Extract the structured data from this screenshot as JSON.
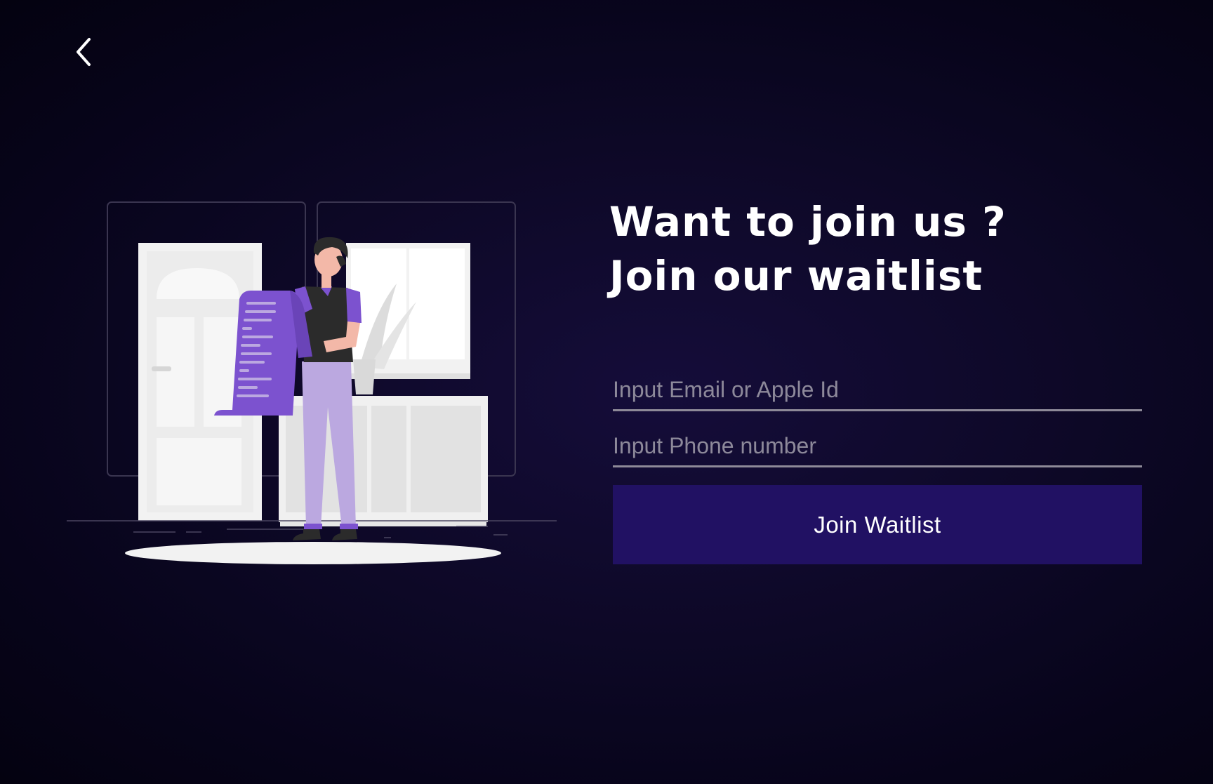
{
  "navigation": {
    "back_icon": "chevron-left-icon"
  },
  "headline": {
    "line1": "Want to join us ?",
    "line2": "Join our waitlist"
  },
  "form": {
    "email_placeholder": "Input Email or Apple Id",
    "email_value": "",
    "phone_placeholder": "Input Phone number",
    "phone_value": "",
    "submit_label": "Join Waitlist"
  },
  "colors": {
    "background": "#0d0826",
    "button": "#211163",
    "accent_purple": "#7c52cf",
    "light_purple": "#bba8e0",
    "underline": "#8e8a98"
  }
}
